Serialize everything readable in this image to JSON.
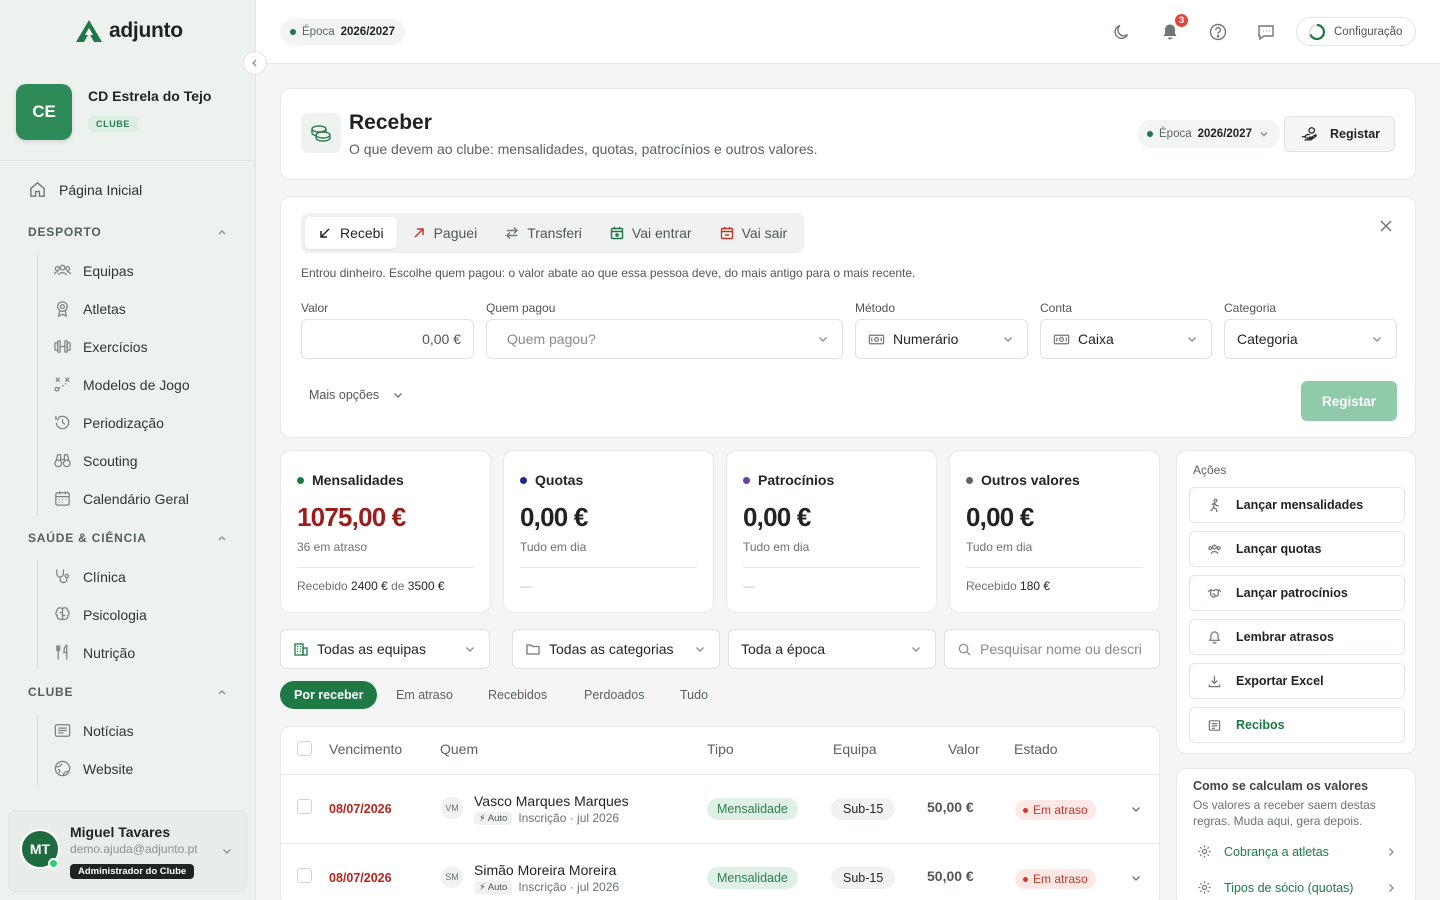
{
  "brand": {
    "name": "adjunto"
  },
  "club": {
    "initials": "CE",
    "name": "CD Estrela do Tejo",
    "badge": "CLUBE"
  },
  "nav": {
    "home": "Página Inicial",
    "sections": [
      {
        "title": "DESPORTO",
        "items": [
          "Equipas",
          "Atletas",
          "Exercícios",
          "Modelos de Jogo",
          "Periodização",
          "Scouting",
          "Calendário Geral"
        ]
      },
      {
        "title": "SAÚDE & CIÊNCIA",
        "items": [
          "Clínica",
          "Psicologia",
          "Nutrição"
        ]
      },
      {
        "title": "CLUBE",
        "items": [
          "Notícias",
          "Website"
        ]
      }
    ]
  },
  "user": {
    "initials": "MT",
    "name": "Miguel Tavares",
    "email": "demo.ajuda@adjunto.pt",
    "role": "Administrador do Clube"
  },
  "topbar": {
    "season_label": "Época",
    "season_value": "2026/2027",
    "notifications": "3",
    "config_label": "Configuração"
  },
  "header": {
    "title": "Receber",
    "subtitle": "O que devem ao clube: mensalidades, quotas, patrocínios e outros valores.",
    "season_label": "Época",
    "season_value": "2026/2027",
    "register_label": "Registar"
  },
  "form": {
    "tabs": [
      "Recebi",
      "Paguei",
      "Transferi",
      "Vai entrar",
      "Vai sair"
    ],
    "active_tab": "Recebi",
    "help": "Entrou dinheiro. Escolhe quem pagou: o valor abate ao que essa pessoa deve, do mais antigo para o mais recente.",
    "labels": {
      "valor": "Valor",
      "quem": "Quem pagou",
      "metodo": "Método",
      "conta": "Conta",
      "categoria": "Categoria"
    },
    "values": {
      "valor": "0,00 €",
      "quem_placeholder": "Quem pagou?",
      "metodo": "Numerário",
      "conta": "Caixa",
      "categoria": "Categoria"
    },
    "more_options": "Mais opções",
    "submit": "Registar"
  },
  "stats": [
    {
      "title": "Mensalidades",
      "value": "1075,00 €",
      "sub": "36 em atraso",
      "foot_prefix": "Recebido",
      "foot_a": "2400 €",
      "foot_mid": "de",
      "foot_b": "3500 €",
      "dot": "#1e7a45",
      "value_color": "#9b1c1c"
    },
    {
      "title": "Quotas",
      "value": "0,00 €",
      "sub": "Tudo em dia",
      "foot": "—",
      "dot": "#1e2a8a",
      "value_color": "#1f2421"
    },
    {
      "title": "Patrocínios",
      "value": "0,00 €",
      "sub": "Tudo em dia",
      "foot": "—",
      "dot": "#6b3fa0",
      "value_color": "#1f2421"
    },
    {
      "title": "Outros valores",
      "value": "0,00 €",
      "sub": "Tudo em dia",
      "foot_prefix": "Recebido",
      "foot_a": "180 €",
      "dot": "#5d6660",
      "value_color": "#1f2421"
    }
  ],
  "filters": {
    "teams": "Todas as equipas",
    "categories": "Todas as categorias",
    "period": "Toda a época",
    "search_placeholder": "Pesquisar nome ou descri"
  },
  "status_tabs": [
    "Por receber",
    "Em atraso",
    "Recebidos",
    "Perdoados",
    "Tudo"
  ],
  "table": {
    "columns": [
      "Vencimento",
      "Quem",
      "Tipo",
      "Equipa",
      "Valor",
      "Estado"
    ],
    "rows": [
      {
        "due": "08/07/2026",
        "initials": "VM",
        "name": "Vasco Marques Marques",
        "auto": "Auto",
        "desc": "Inscrição · jul 2026",
        "type": "Mensalidade",
        "team": "Sub-15",
        "value": "50,00 €",
        "status": "Em atraso"
      },
      {
        "due": "08/07/2026",
        "initials": "SM",
        "name": "Simão Moreira Moreira",
        "auto": "Auto",
        "desc": "Inscrição · jul 2026",
        "type": "Mensalidade",
        "team": "Sub-15",
        "value": "50,00 €",
        "status": "Em atraso"
      }
    ]
  },
  "actions": {
    "title": "Ações",
    "items": [
      "Lançar mensalidades",
      "Lançar quotas",
      "Lançar patrocínios",
      "Lembrar atrasos",
      "Exportar Excel",
      "Recibos"
    ]
  },
  "calc": {
    "title": "Como se calculam os valores",
    "desc": "Os valores a receber saem destas regras. Muda aqui, gera depois.",
    "links": [
      "Cobrança a atletas",
      "Tipos de sócio (quotas)"
    ]
  }
}
